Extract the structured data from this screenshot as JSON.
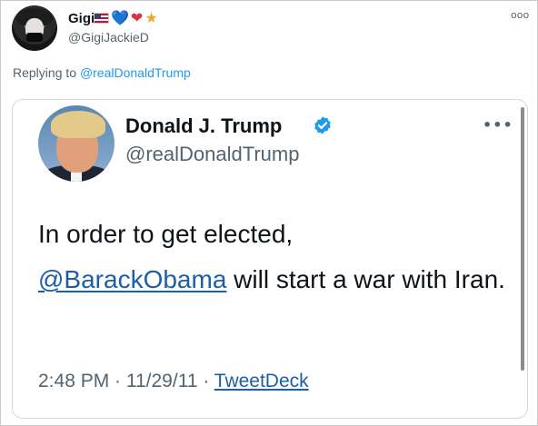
{
  "reply_tweet": {
    "display_name": "Gigi",
    "name_emojis": [
      "us-flag-icon",
      "💙",
      "❤",
      "★"
    ],
    "handle": "@GigiJackieD",
    "more_label": "ooo",
    "replying_to_prefix": "Replying to ",
    "replying_to_handle": "@realDonaldTrump"
  },
  "embedded_tweet": {
    "display_name": "Donald J. Trump",
    "handle": "@realDonaldTrump",
    "more_label": "•••",
    "text_part1": "In order to get elected,",
    "mention": "@BarackObama",
    "text_part2": " will start a war with Iran.",
    "time": "2:48 PM · 11/29/11 · ",
    "source": "TweetDeck"
  },
  "colors": {
    "link_blue": "#1d9bf0",
    "embed_link_blue": "#1b5fa8",
    "verified_blue": "#1d9bf0",
    "muted_gray": "#536471"
  }
}
